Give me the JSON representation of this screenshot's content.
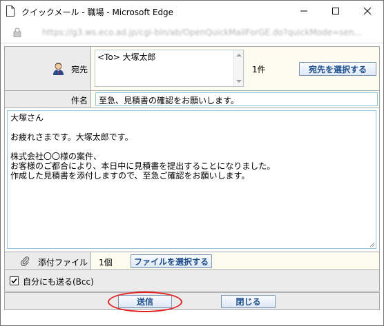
{
  "window": {
    "title": "クイックメール - 職場 - Microsoft Edge",
    "url": "https://g3.ws.eco.ad.jp/cgi-bin/ab/OpenQuickMailForGE.do?quickMode=sen..."
  },
  "form": {
    "to_label": "宛先",
    "to_recipient": "<To> 大塚太郎",
    "to_count": "1件",
    "select_to_button": "宛先を選択する",
    "subject_label": "件名",
    "subject_value": "至急、見積書の確認をお願いします。",
    "body_lines": [
      "大塚さん",
      "",
      "お疲れさまです。大塚太郎です。",
      "",
      "株式会社〇〇様の案件、",
      "お客様のご都合により、本日中に見積書を提出することになりました。",
      "作成した見積書を添付しますので、至急ご確認をお願いします。"
    ],
    "attach_label": "添付ファイル",
    "attach_count": "1個",
    "select_file_button": "ファイルを選択する",
    "bcc_label": "自分にも送る(Bcc)",
    "bcc_checked": true
  },
  "footer": {
    "send_button": "送信",
    "close_button": "閉じる"
  },
  "colors": {
    "highlight": "#e02020",
    "button_text": "#1f4e8c",
    "label_bg": "#ebebeb",
    "value_bg": "#fdfcee"
  },
  "icons": {
    "page": "page-icon",
    "lock": "lock-icon",
    "person": "person-icon",
    "clip": "paperclip-icon",
    "minimize": "minimize-icon",
    "maximize": "maximize-icon",
    "close": "close-icon"
  }
}
